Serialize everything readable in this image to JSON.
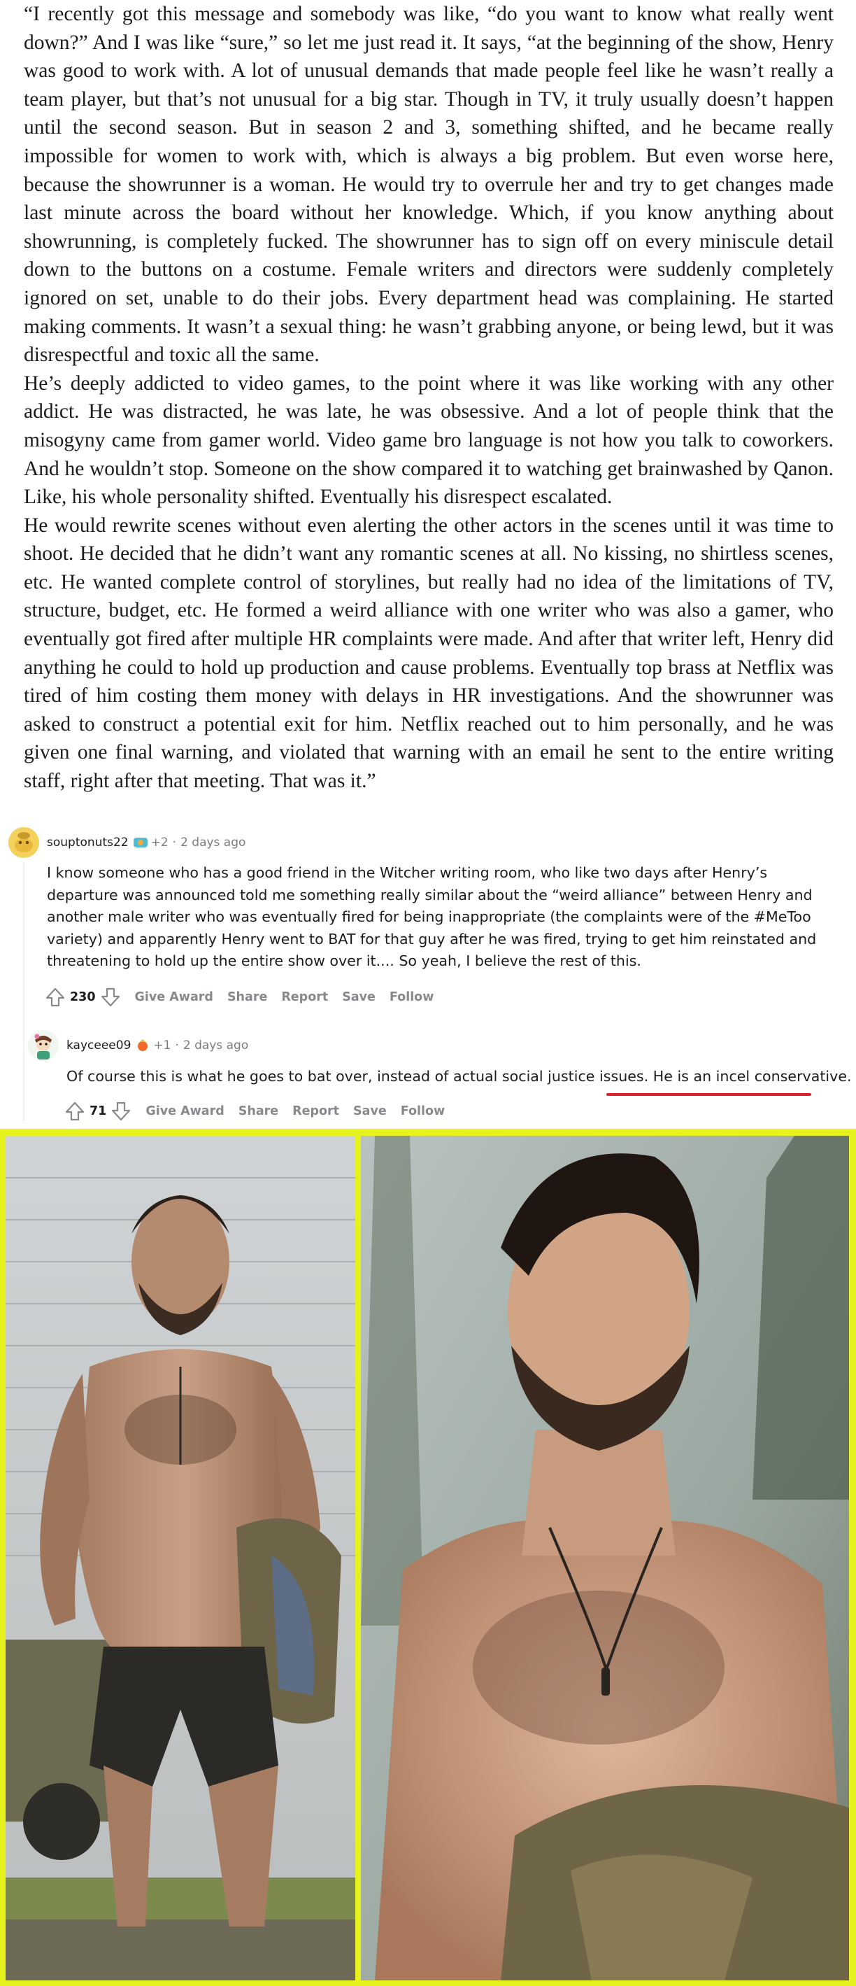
{
  "quote": {
    "paragraphs": [
      "“I recently got this message and somebody was like, “do you want to know what really went down?” And I was like “sure,” so let me just read it. It says, “at the beginning of the show, Henry was good to work with. A lot of unusual demands that made people feel like he wasn’t really a team player, but that’s not unusual for a big star. Though in TV, it truly usually doesn’t happen until the second season. But in season 2 and 3, something shifted, and he became really impossible for women to work with, which is always a big problem. But even worse here, because the showrunner is a woman. He would try to overrule her and try to get changes made last minute across the board without her knowledge. Which, if you know anything about showrunning, is completely fucked. The showrunner has to sign off on every miniscule detail down to the buttons on a costume. Female writers and directors were suddenly completely ignored on set, unable to do their jobs. Every department head was complaining. He started making comments. It wasn’t a sexual thing: he wasn’t grabbing anyone, or being lewd, but it was disrespectful and toxic all the same.",
      "He’s deeply addicted to video games, to the point where it was like working with any other addict. He was distracted, he was late, he was obsessive. And a lot of people think that the misogyny came from gamer world. Video game bro language is not how you talk to coworkers. And he wouldn’t stop. Someone on the show compared it to watching get brainwashed by Qanon. Like, his whole personality shifted. Eventually his disrespect escalated.",
      "He would rewrite scenes without even alerting the other actors in the scenes until it was time to shoot. He decided that he didn’t want any romantic scenes at all. No kissing, no shirtless scenes, etc. He wanted complete control of storylines, but really had no idea of the limitations of TV, structure, budget, etc. He formed a weird alliance with one writer who was also a gamer, who eventually got fired after multiple HR complaints were made. And after that writer left, Henry did anything he could to hold up production and cause problems. Eventually top brass at Netflix was tired of him costing them money with delays in HR investigations. And the showrunner was asked to construct a potential exit for him. Netflix reached out to him personally, and he was given one final warning, and violated that warning with an email he sent to the entire writing staff, right after that meeting. That was it.”"
    ]
  },
  "comments": [
    {
      "username": "souptonuts22",
      "award_count": "+2",
      "separator": "·",
      "time": "2 days ago",
      "body": "I know someone who has a good friend in the Witcher writing room, who like two days after Henry’s departure was announced told me something really similar about the “weird alliance” between Henry and another male writer who was eventually fired for being inappropriate (the complaints were of the #MeToo variety) and apparently Henry went to BAT for that guy after he was fired, trying to get him reinstated and threatening to hold up the entire show over it.... So yeah, I believe the rest of this.",
      "votes": "230",
      "actions": [
        "Give Award",
        "Share",
        "Report",
        "Save",
        "Follow"
      ]
    },
    {
      "username": "kayceee09",
      "award_count": "+1",
      "separator": "·",
      "time": "2 days ago",
      "body_plain": "Of course this is what he goes to bat over, instead of actual social justice issues. ",
      "body_underlined": "He is an incel conservative.",
      "votes": "71",
      "actions": [
        "Give Award",
        "Share",
        "Report",
        "Save",
        "Follow"
      ]
    }
  ],
  "colors": {
    "frame": "#e6f21c",
    "underline": "#d8232a",
    "meta": "#7c7c7c",
    "action": "#878a8c"
  },
  "icons": {
    "upvote": "arrow-up-outline-icon",
    "downvote": "arrow-down-outline-icon",
    "avatar1": "snoo-avatar-icon",
    "avatar2": "snoo-avatar-icon",
    "award": "award-icon"
  }
}
